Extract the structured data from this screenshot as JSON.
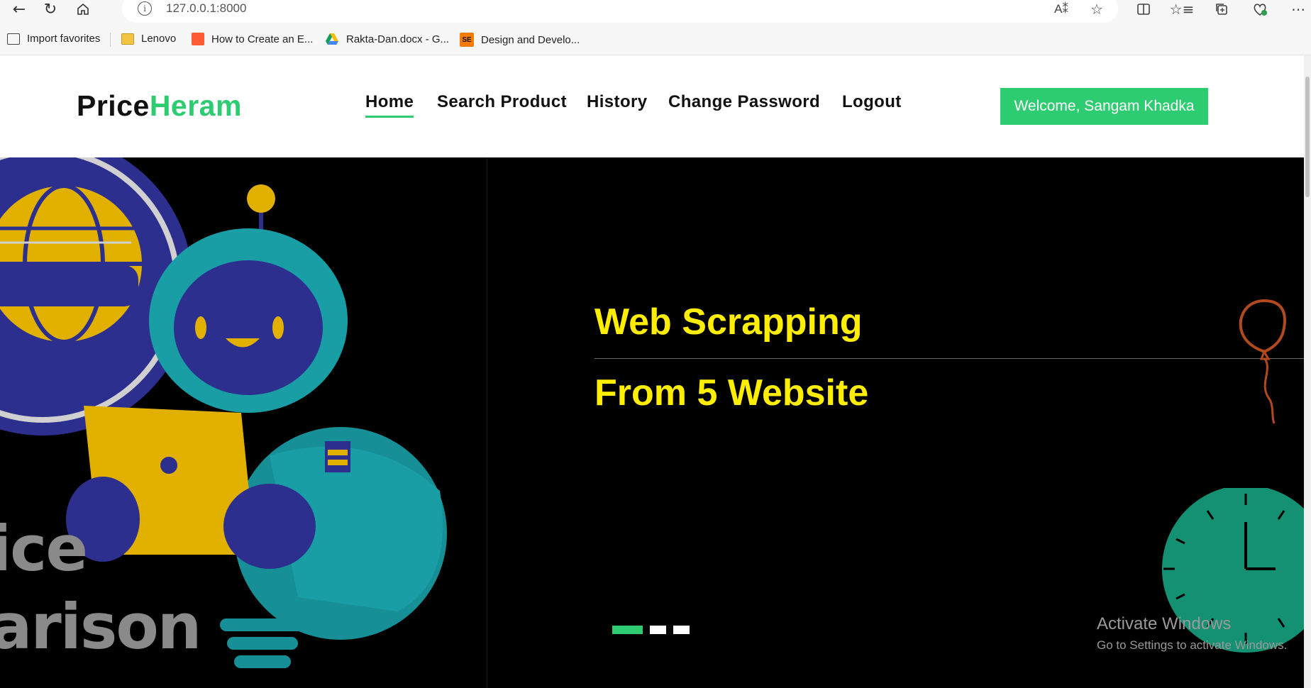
{
  "browser": {
    "url": "127.0.0.1:8000",
    "favorites": [
      {
        "label": "Import favorites",
        "icon": "import-icon"
      },
      {
        "label": "Lenovo",
        "icon": "folder-icon"
      },
      {
        "label": "How to Create an E...",
        "icon": "hubspot-icon"
      },
      {
        "label": "Rakta-Dan.docx - G...",
        "icon": "google-drive-icon"
      },
      {
        "label": "Design and Develo...",
        "icon": "se-icon"
      }
    ]
  },
  "site": {
    "logo_part1": "Price",
    "logo_part2": "Heram",
    "nav": [
      {
        "label": "Home",
        "active": true
      },
      {
        "label": "Search Product",
        "active": false
      },
      {
        "label": "History",
        "active": false
      },
      {
        "label": "Change Password",
        "active": false
      },
      {
        "label": "Logout",
        "active": false
      }
    ],
    "welcome": "Welcome, Sangam Khadka",
    "accent_color": "#2ecc71"
  },
  "hero": {
    "title_line1": "Web Scrapping",
    "title_line2": "From 5 Website",
    "title_color": "#ffee00",
    "image_text_1": "ice",
    "image_text_2": "arison",
    "slides": 3,
    "active_slide": 1
  },
  "watermark": {
    "line1": "Activate Windows",
    "line2": "Go to Settings to activate Windows."
  }
}
